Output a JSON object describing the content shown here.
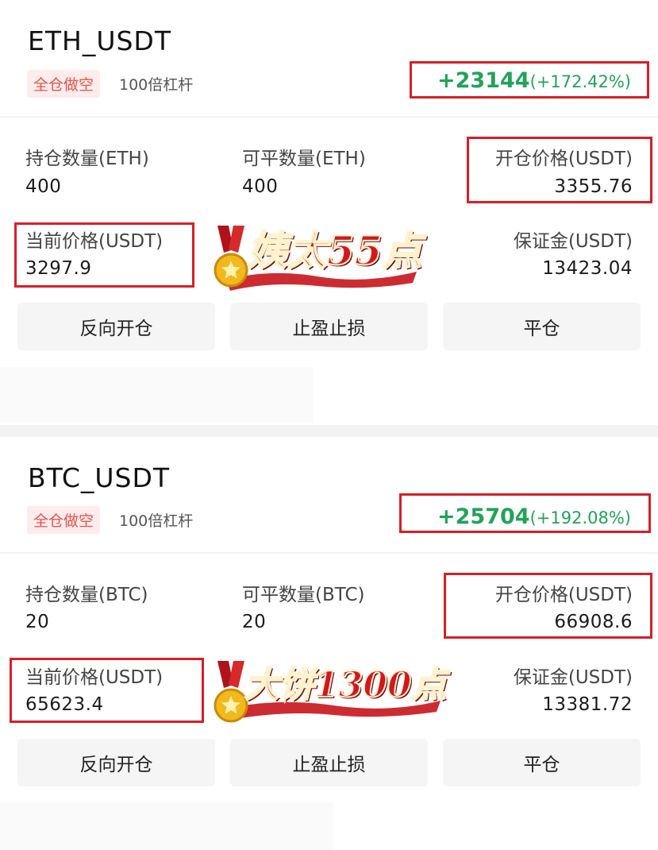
{
  "positions": [
    {
      "pair": "ETH_USDT",
      "mode_badge": "全仓做空",
      "leverage": "100倍杠杆",
      "pnl_value": "+23144",
      "pnl_percent": "(+172.42%)",
      "fields": {
        "holding_qty_label": "持仓数量(ETH)",
        "holding_qty_value": "400",
        "closable_qty_label": "可平数量(ETH)",
        "closable_qty_value": "400",
        "open_price_label": "开仓价格(USDT)",
        "open_price_value": "3355.76",
        "current_price_label": "当前价格(USDT)",
        "current_price_value": "3297.9",
        "margin_label": "保证金(USDT)",
        "margin_value": "13423.04"
      },
      "stamp_text": "姨太55点",
      "buttons": {
        "reverse": "反向开仓",
        "tp_sl": "止盈止损",
        "close": "平仓"
      }
    },
    {
      "pair": "BTC_USDT",
      "mode_badge": "全仓做空",
      "leverage": "100倍杠杆",
      "pnl_value": "+25704",
      "pnl_percent": "(+192.08%)",
      "fields": {
        "holding_qty_label": "持仓数量(BTC)",
        "holding_qty_value": "20",
        "closable_qty_label": "可平数量(BTC)",
        "closable_qty_value": "20",
        "open_price_label": "开仓价格(USDT)",
        "open_price_value": "66908.6",
        "current_price_label": "当前价格(USDT)",
        "current_price_value": "65623.4",
        "margin_label": "保证金(USDT)",
        "margin_value": "13381.72"
      },
      "stamp_text": "大饼1300点",
      "buttons": {
        "reverse": "反向开仓",
        "tp_sl": "止盈止损",
        "close": "平仓"
      }
    }
  ],
  "colors": {
    "profit_green": "#22a35a",
    "short_badge_red": "#e5534b",
    "highlight_red": "#d61f26"
  },
  "icons": [
    "medal-icon"
  ]
}
